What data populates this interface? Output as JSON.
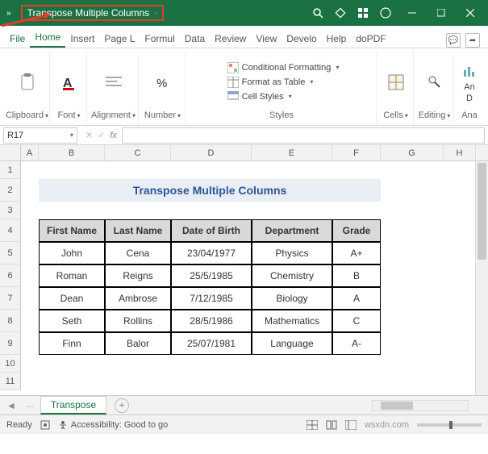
{
  "titlebar": {
    "filename": "Transpose Multiple Columns"
  },
  "tabs": {
    "file": "File",
    "home": "Home",
    "insert": "Insert",
    "page": "Page L",
    "formulas": "Formul",
    "data": "Data",
    "review": "Review",
    "view": "View",
    "develo": "Develo",
    "help": "Help",
    "dopdf": "doPDF"
  },
  "ribbon": {
    "clipboard": "Clipboard",
    "font": "Font",
    "alignment": "Alignment",
    "number": "Number",
    "cond_fmt": "Conditional Formatting",
    "fmt_table": "Format as Table",
    "cell_styles": "Cell Styles",
    "styles": "Styles",
    "cells": "Cells",
    "editing": "Editing",
    "analyze1": "An",
    "analyze2": "D",
    "analyze_group": "Ana"
  },
  "namebox": "R17",
  "fx_label": "fx",
  "columns": {
    "A": "A",
    "B": "B",
    "C": "C",
    "D": "D",
    "E": "E",
    "F": "F",
    "G": "G",
    "H": "H"
  },
  "row_nums": [
    "1",
    "2",
    "3",
    "4",
    "5",
    "6",
    "7",
    "8",
    "9",
    "10",
    "11"
  ],
  "sheet": {
    "title": "Transpose Multiple Columns",
    "headers": {
      "first": "First Name",
      "last": "Last Name",
      "dob": "Date of Birth",
      "dept": "Department",
      "grade": "Grade"
    },
    "rows": [
      {
        "first": "John",
        "last": "Cena",
        "dob": "23/04/1977",
        "dept": "Physics",
        "grade": "A+"
      },
      {
        "first": "Roman",
        "last": "Reigns",
        "dob": "25/5/1985",
        "dept": "Chemistry",
        "grade": "B"
      },
      {
        "first": "Dean",
        "last": "Ambrose",
        "dob": "7/12/1985",
        "dept": "Biology",
        "grade": "A"
      },
      {
        "first": "Seth",
        "last": "Rollins",
        "dob": "28/5/1986",
        "dept": "Mathematics",
        "grade": "C"
      },
      {
        "first": "Finn",
        "last": "Balor",
        "dob": "25/07/1981",
        "dept": "Language",
        "grade": "A-"
      }
    ]
  },
  "sheet_tab": "Transpose",
  "status": {
    "ready": "Ready",
    "access": "Accessibility: Good to go",
    "watermark": "wsxdn.com"
  }
}
